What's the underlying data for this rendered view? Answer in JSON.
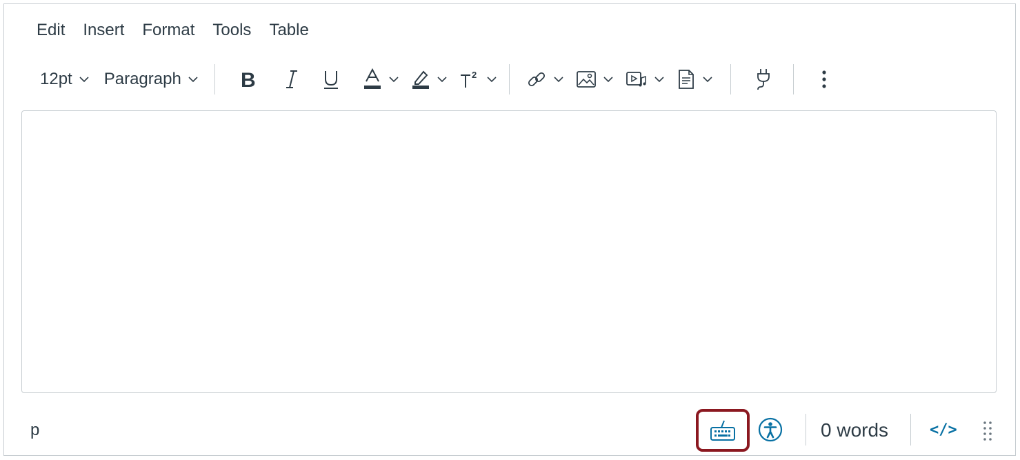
{
  "menubar": {
    "items": [
      "Edit",
      "Insert",
      "Format",
      "Tools",
      "Table"
    ]
  },
  "toolbar": {
    "font_size": "12pt",
    "block_format": "Paragraph",
    "buttons": {
      "bold": "bold-icon",
      "italic": "italic-icon",
      "underline": "underline-icon",
      "text_color": "text-color-icon",
      "background_color": "highlight-icon",
      "superscript": "superscript-icon",
      "link": "link-icon",
      "image": "image-icon",
      "media": "media-icon",
      "document": "document-icon",
      "apps": "plug-icon",
      "more": "more-vertical-icon"
    }
  },
  "editor": {
    "content": ""
  },
  "statusbar": {
    "element_path": "p",
    "word_count": "0 words",
    "html_toggle": "</>",
    "icons": {
      "keyboard": "keyboard-icon",
      "accessibility": "accessibility-icon",
      "resize": "resize-grip-icon"
    }
  },
  "colors": {
    "text": "#2d3b45",
    "border": "#c7cdd1",
    "accent_blue": "#0770a3",
    "highlight_box": "#8b1820"
  }
}
